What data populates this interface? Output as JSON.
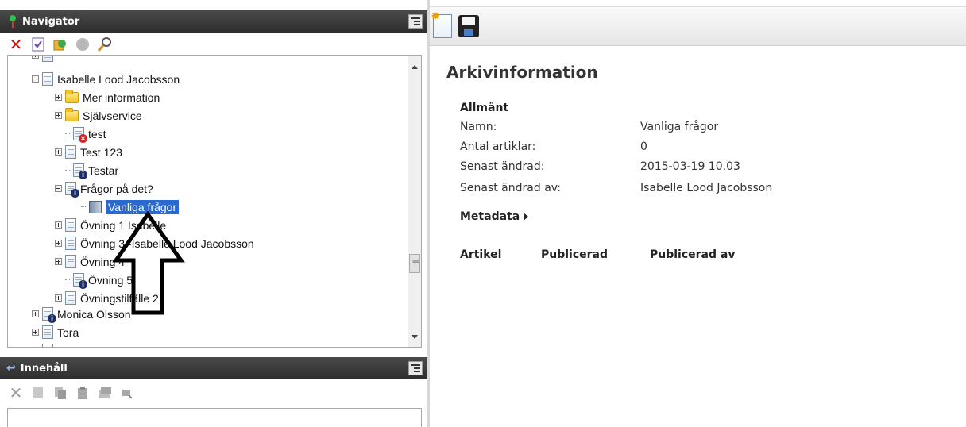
{
  "navigator": {
    "title": "Navigator",
    "toolbar": [
      "delete-icon",
      "checklist-icon",
      "sync-icon",
      "circle-icon",
      "search-icon"
    ]
  },
  "tree": {
    "items": [
      {
        "label": "Isabelle Lood Jacobsson",
        "icon": "doc",
        "expander": "minus",
        "level": 1
      },
      {
        "label": "Mer information",
        "icon": "folder",
        "expander": "plus",
        "level": 2
      },
      {
        "label": "Självservice",
        "icon": "folder",
        "expander": "plus",
        "level": 2
      },
      {
        "label": "test",
        "icon": "doc-error",
        "expander": "none",
        "level": 2
      },
      {
        "label": "Test 123",
        "icon": "doc",
        "expander": "plus",
        "level": 2
      },
      {
        "label": "Testar",
        "icon": "doc-info",
        "expander": "none",
        "level": 2
      },
      {
        "label": "Frågor på det?",
        "icon": "doc-info",
        "expander": "minus",
        "level": 2
      },
      {
        "label": "Vanliga frågor",
        "icon": "archive",
        "expander": "none",
        "level": 3,
        "selected": true
      },
      {
        "label": "Övning 1 Isabelle",
        "icon": "doc",
        "expander": "plus",
        "level": 2
      },
      {
        "label": "Övning 3 -Isabelle Lood Jacobsson",
        "icon": "doc",
        "expander": "plus",
        "level": 2
      },
      {
        "label": "Övning 4",
        "icon": "doc",
        "expander": "plus",
        "level": 2
      },
      {
        "label": "Övning 5",
        "icon": "doc-info",
        "expander": "none",
        "level": 2
      },
      {
        "label": "Övningstilfälle 2",
        "icon": "doc",
        "expander": "plus",
        "level": 2
      },
      {
        "label": "Monica Olsson",
        "icon": "doc-info",
        "expander": "plus",
        "level": 1
      },
      {
        "label": "Tora",
        "icon": "doc",
        "expander": "plus",
        "level": 1
      }
    ]
  },
  "content_panel": {
    "title": "Innehåll",
    "toolbar": [
      "delete-icon",
      "checklist-icon",
      "copy-icon",
      "paste-icon",
      "stack-icon",
      "search-icon"
    ]
  },
  "archive_info": {
    "heading": "Arkivinformation",
    "general_heading": "Allmänt",
    "fields": [
      {
        "label": "Namn:",
        "value": "Vanliga frågor"
      },
      {
        "label": "Antal artiklar:",
        "value": "0"
      },
      {
        "label": "Senast ändrad:",
        "value": "2015-03-19 10.03"
      },
      {
        "label": "Senast ändrad av:",
        "value": "Isabelle Lood Jacobsson"
      }
    ],
    "metadata_label": "Metadata",
    "table_headers": [
      "Artikel",
      "Publicerad",
      "Publicerad av"
    ]
  }
}
